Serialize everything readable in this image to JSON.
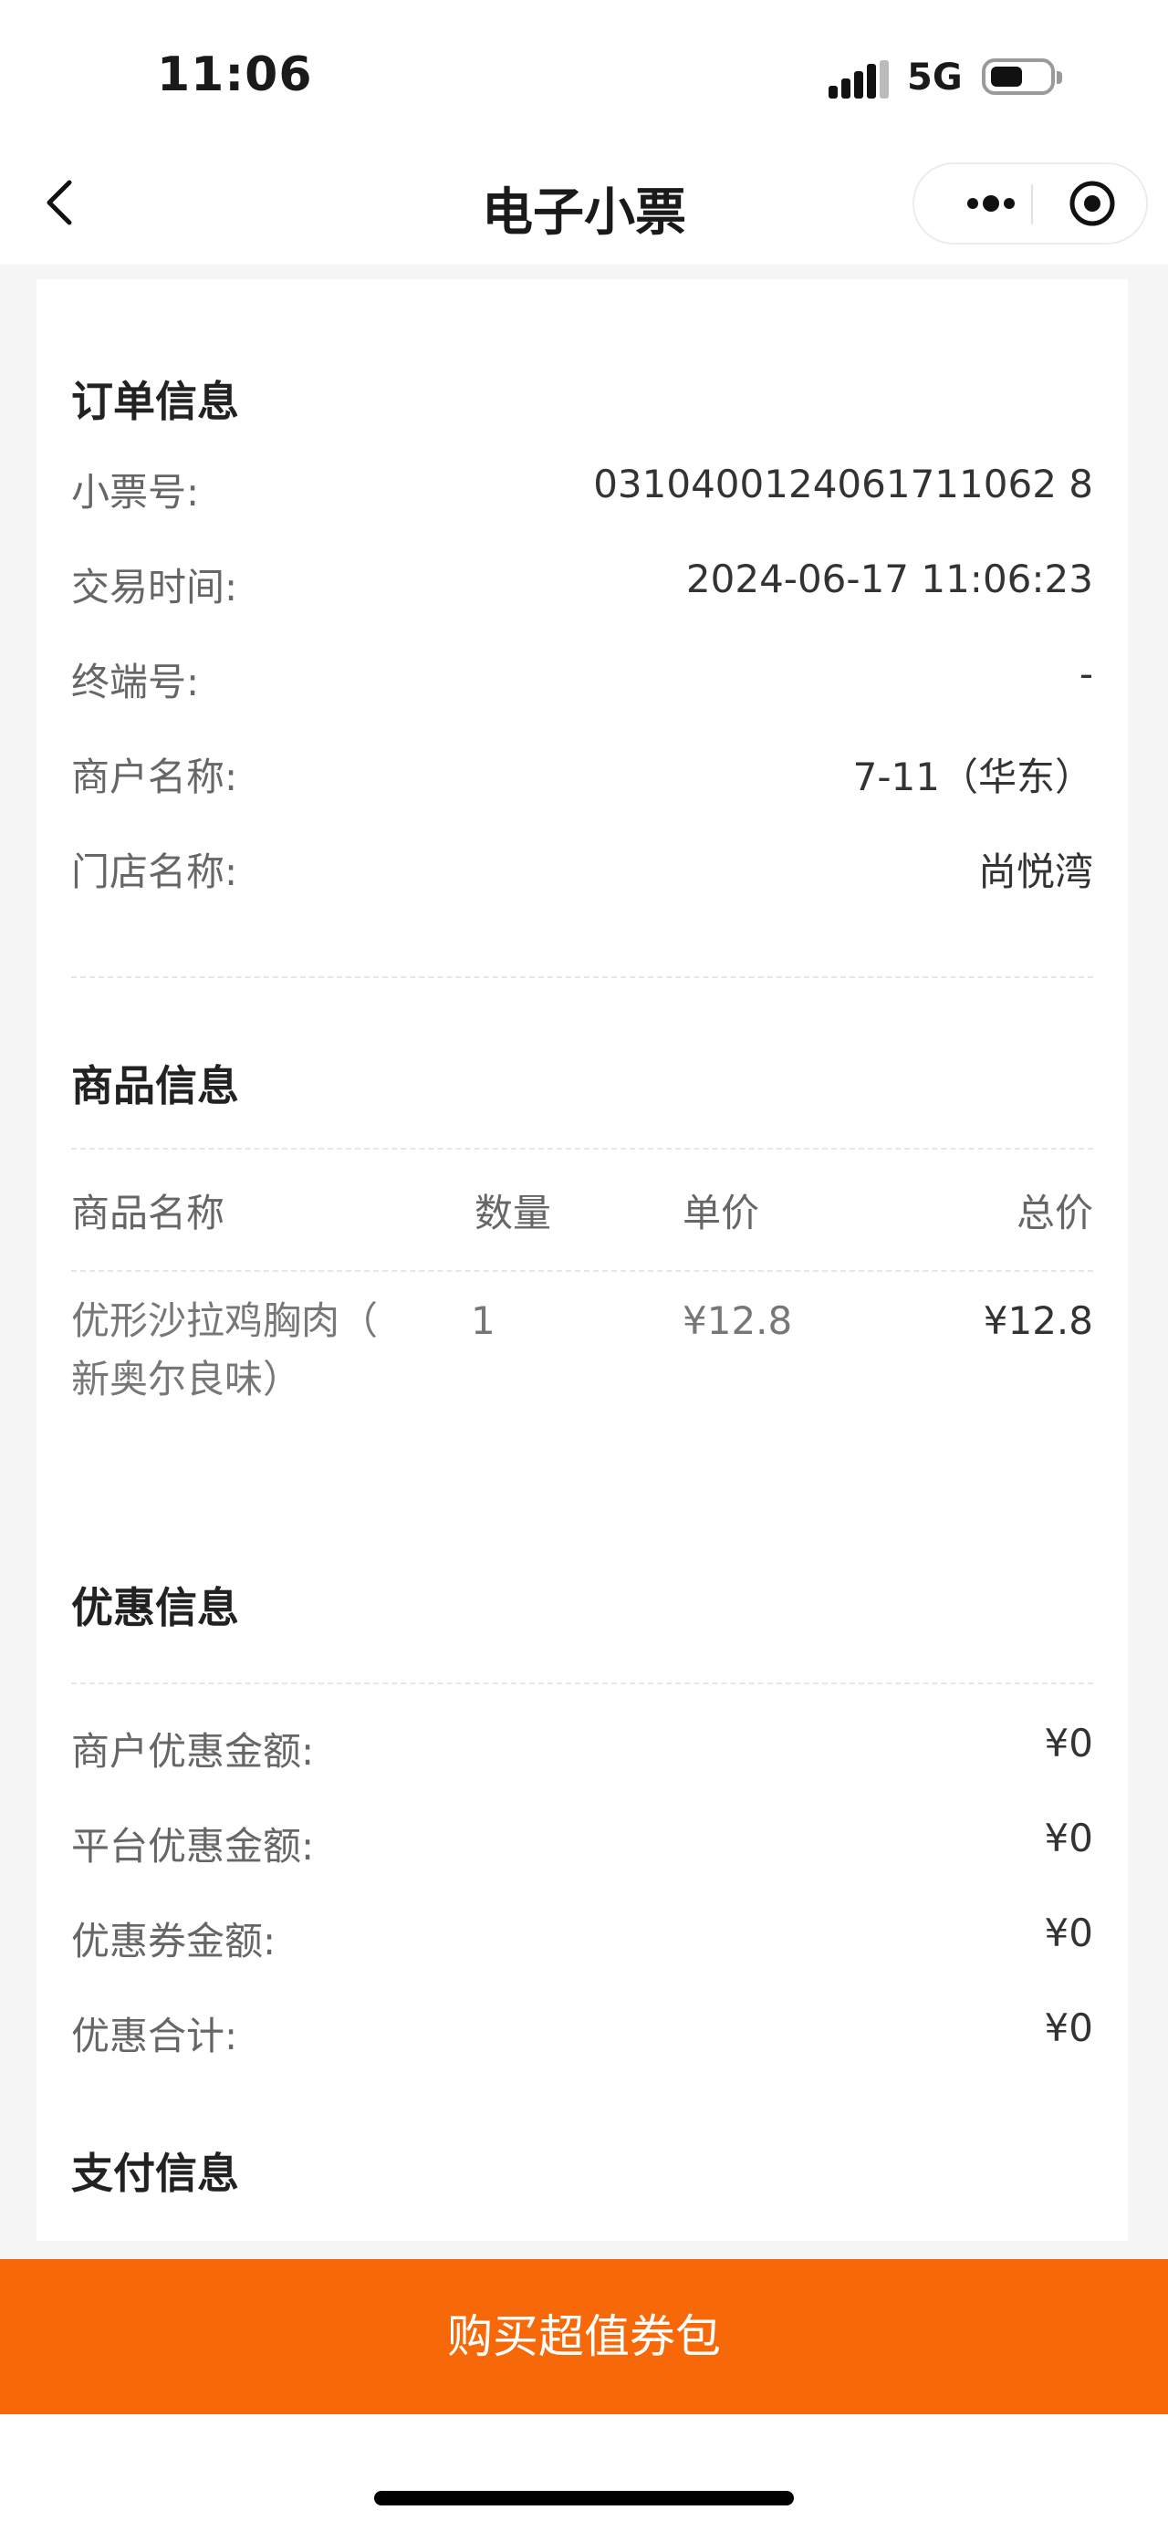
{
  "status_bar": {
    "time": "11:06",
    "network": "5G"
  },
  "nav": {
    "title": "电子小票"
  },
  "order": {
    "title": "订单信息",
    "rows": [
      {
        "label": "小票号:",
        "value": "0310400124061711062 8"
      },
      {
        "label": "交易时间:",
        "value": "2024-06-17 11:06:23"
      },
      {
        "label": "终端号:",
        "value": "-"
      },
      {
        "label": "商户名称:",
        "value": "7-11（华东）"
      },
      {
        "label": "门店名称:",
        "value": "尚悦湾"
      }
    ]
  },
  "goods": {
    "title": "商品信息",
    "headers": {
      "name": "商品名称",
      "qty": "数量",
      "unit": "单价",
      "total": "总价"
    },
    "items": [
      {
        "name_line1": "优形沙拉鸡胸肉（",
        "name_line2": "新奥尔良味）",
        "qty": "1",
        "unit": "¥12.8",
        "total": "¥12.8"
      }
    ]
  },
  "discount": {
    "title": "优惠信息",
    "rows": [
      {
        "label": "商户优惠金额:",
        "value": "¥0"
      },
      {
        "label": "平台优惠金额:",
        "value": "¥0"
      },
      {
        "label": "优惠券金额:",
        "value": "¥0"
      },
      {
        "label": "优惠合计:",
        "value": "¥0"
      }
    ]
  },
  "payment": {
    "title": "支付信息"
  },
  "cta": {
    "label": "购买超值券包"
  }
}
